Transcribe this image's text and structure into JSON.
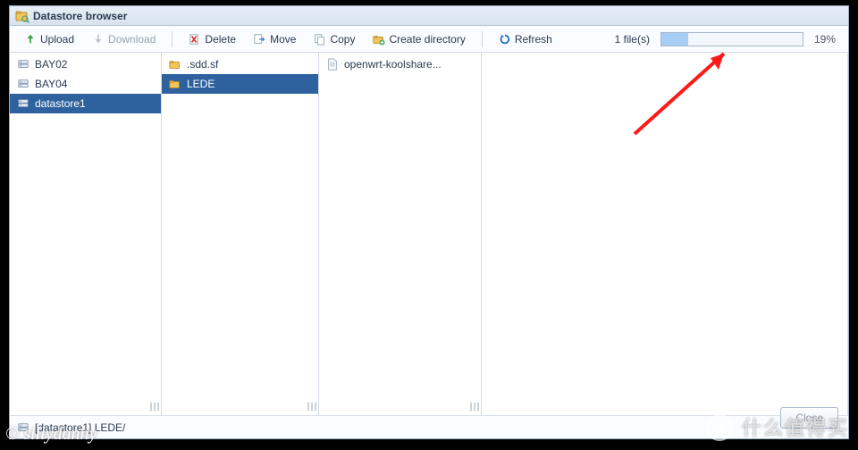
{
  "title": "Datastore browser",
  "toolbar": {
    "upload": "Upload",
    "download": "Download",
    "delete": "Delete",
    "move": "Move",
    "copy": "Copy",
    "create_dir": "Create directory",
    "refresh": "Refresh",
    "file_count": "1 file(s)",
    "progress_pct": 19,
    "progress_label": "19%"
  },
  "columns": {
    "datastores": [
      {
        "name": "BAY02",
        "selected": false
      },
      {
        "name": "BAY04",
        "selected": false
      },
      {
        "name": "datastore1",
        "selected": true
      }
    ],
    "folders1": [
      {
        "name": ".sdd.sf",
        "selected": false
      },
      {
        "name": "LEDE",
        "selected": true
      }
    ],
    "files": [
      {
        "name": "openwrt-koolshare...",
        "selected": false
      }
    ]
  },
  "status": {
    "path": "[datastore1] LEDE/"
  },
  "close_label": "Close",
  "watermark_left": "© sillydanny",
  "watermark_right": "什么值得买",
  "watermark_badge": "值"
}
